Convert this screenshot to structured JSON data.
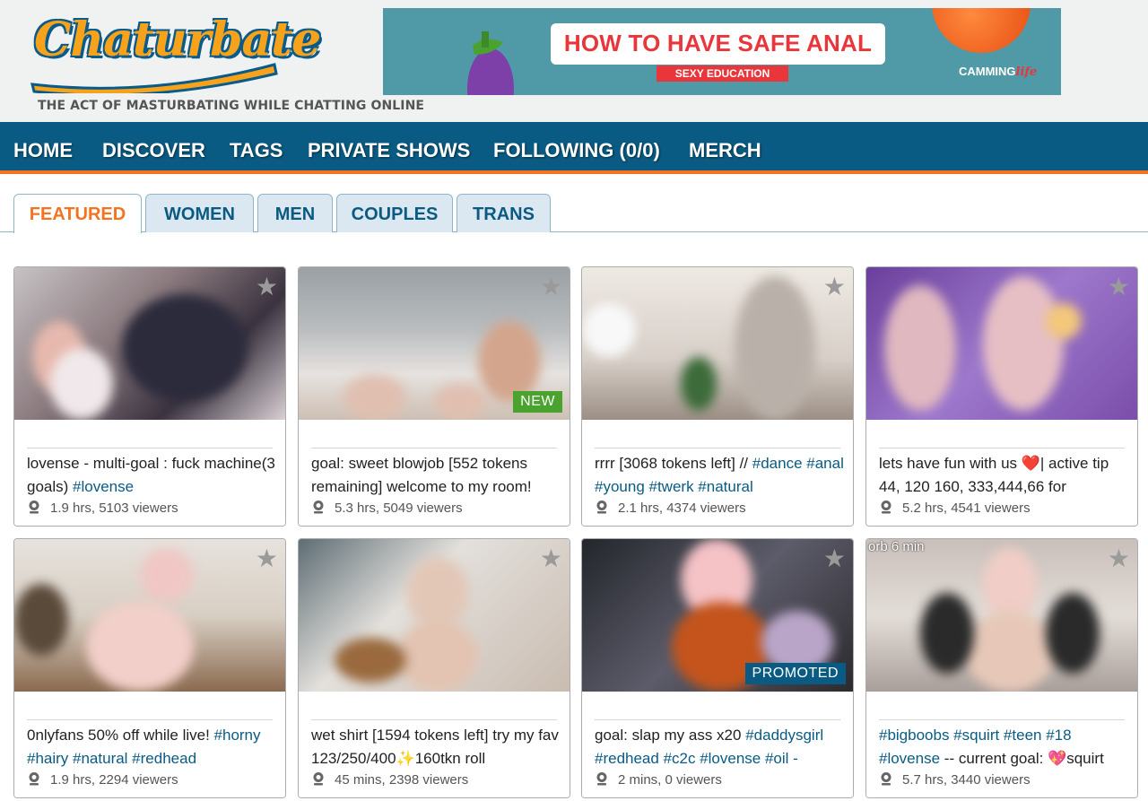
{
  "brand": {
    "logo_text": "Chaturbate",
    "tagline": "THE ACT OF MASTURBATING WHILE CHATTING ONLINE"
  },
  "banner": {
    "title": "HOW TO HAVE SAFE ANAL",
    "subtitle": "SEXY EDUCATION",
    "brand_a": "CAMMING",
    "brand_b": "life"
  },
  "nav": [
    "HOME",
    "DISCOVER",
    "TAGS",
    "PRIVATE SHOWS",
    "FOLLOWING (0/0)",
    "MERCH"
  ],
  "tabs": [
    "FEATURED",
    "WOMEN",
    "MEN",
    "COUPLES",
    "TRANS"
  ],
  "active_tab": "FEATURED",
  "cards": [
    {
      "username": "",
      "subject_text": "lovense - multi-goal : fuck machine(3 goals) ",
      "subject_tags": "#lovense",
      "time": "1.9 hrs",
      "viewers": "5103 viewers",
      "badge": "",
      "overlay": ""
    },
    {
      "username": "",
      "subject_text": "goal: sweet blowjob [552 tokens remaining] welcome to my room!",
      "subject_tags": "",
      "time": "5.3 hrs",
      "viewers": "5049 viewers",
      "badge": "NEW",
      "overlay": ""
    },
    {
      "username": "",
      "subject_text": "rrrr [3068 tokens left] // ",
      "subject_tags": "#dance #anal #young #twerk #natural",
      "time": "2.1 hrs",
      "viewers": "4374 viewers",
      "badge": "",
      "overlay": ""
    },
    {
      "username": "",
      "subject_text": "lets have fun with us ❤️| active tip 44, 120 160, 333,444,66 for",
      "subject_tags": "",
      "time": "5.2 hrs",
      "viewers": "4541 viewers",
      "badge": "",
      "overlay": ""
    },
    {
      "username": "",
      "subject_text": "0nlyfans 50% off while live! ",
      "subject_tags": "#horny #hairy #natural #redhead",
      "time": "1.9 hrs",
      "viewers": "2294 viewers",
      "badge": "",
      "overlay": ""
    },
    {
      "username": "",
      "subject_text": "wet shirt [1594 tokens left] try my fav 123/250/400✨160tkn roll",
      "subject_tags": "",
      "time": "45 mins",
      "viewers": "2398 viewers",
      "badge": "",
      "overlay": ""
    },
    {
      "username": "",
      "subject_text": "goal: slap my ass x20 ",
      "subject_tags": "#daddysgirl #redhead #c2c #lovense #oil -",
      "time": "2 mins",
      "viewers": "0 viewers",
      "badge": "PROMOTED",
      "overlay": ""
    },
    {
      "username": "",
      "subject_text": "",
      "subject_tags": "#bigboobs #squirt #teen #18 #lovense",
      "subject_tail": " -- current goal: 💖squirt",
      "time": "5.7 hrs",
      "viewers": "3440 viewers",
      "badge": "",
      "overlay": "orb 6 min"
    }
  ],
  "colors": {
    "nav_bg": "#0a5b83",
    "accent": "#f47321",
    "tag": "#0a5b83",
    "new_badge": "#4aa32f"
  }
}
